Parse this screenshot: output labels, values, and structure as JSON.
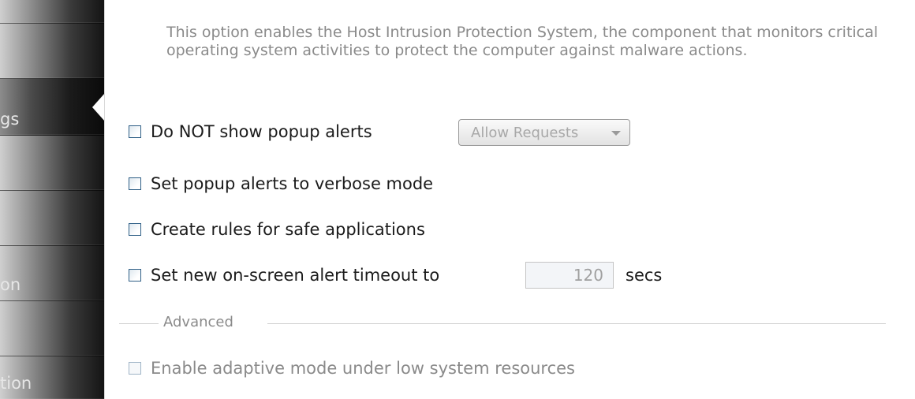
{
  "sidebar": {
    "items": [
      {
        "label": ""
      },
      {
        "label": ""
      },
      {
        "label": "gs"
      },
      {
        "label": ""
      },
      {
        "label": ""
      },
      {
        "label": "on"
      },
      {
        "label": ""
      },
      {
        "label": "tion"
      }
    ],
    "selected_index": 2
  },
  "description": "This option enables the Host Intrusion Protection System, the component that monitors critical operating system activities to protect the computer against malware actions.",
  "options": {
    "no_popup": {
      "label": "Do NOT show popup alerts",
      "checked": false
    },
    "alert_mode": {
      "value": "Allow Requests"
    },
    "verbose": {
      "label": "Set popup alerts to verbose mode",
      "checked": false
    },
    "safe_rules": {
      "label": "Create rules for safe applications",
      "checked": false
    },
    "timeout": {
      "label": "Set new on-screen alert timeout to",
      "value": "120",
      "units": "secs",
      "checked": false
    }
  },
  "advanced": {
    "title": "Advanced",
    "adaptive": {
      "label": "Enable adaptive mode under low system resources",
      "checked": false
    }
  },
  "colors": {
    "checkbox_border": "#2f5f86",
    "description_text": "#8a8a8a",
    "label_text": "#1b1b1b"
  }
}
